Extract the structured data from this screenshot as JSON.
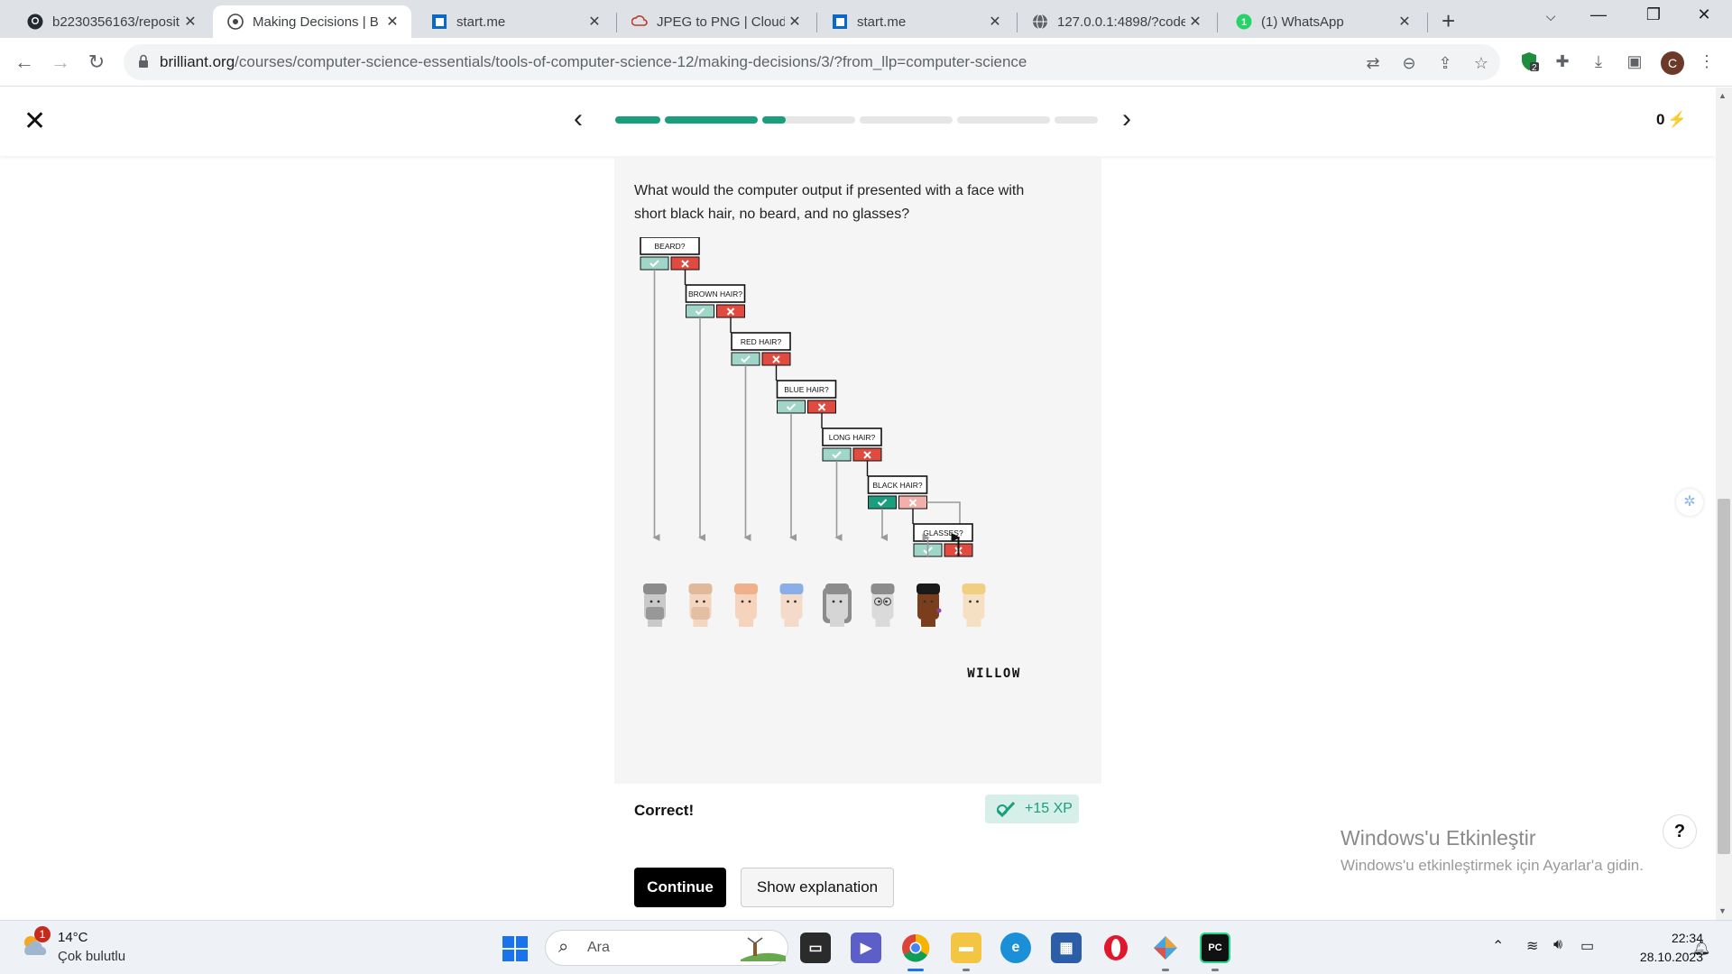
{
  "browser": {
    "tabs": [
      {
        "title": "b2230356163/reposit",
        "icon": "github-icon",
        "active": false
      },
      {
        "title": "Making Decisions | B",
        "icon": "brilliant-icon",
        "active": true
      },
      {
        "title": "start.me",
        "icon": "startme-icon",
        "active": false
      },
      {
        "title": "JPEG to PNG | Cloud",
        "icon": "cloudconvert-icon",
        "active": false
      },
      {
        "title": "start.me",
        "icon": "startme-icon",
        "active": false
      },
      {
        "title": "127.0.0.1:4898/?code",
        "icon": "globe-icon",
        "active": false
      },
      {
        "title": "(1) WhatsApp",
        "icon": "whatsapp-icon",
        "active": false
      }
    ],
    "url_domain": "brilliant.org",
    "url_path": "/courses/computer-science-essentials/tools-of-computer-science-12/making-decisions/3/?from_llp=computer-science",
    "extension_badge": "2",
    "profile_initial": "C"
  },
  "lesson": {
    "progress_segments": [
      1,
      1,
      0.25,
      0,
      0,
      0
    ],
    "score": "0",
    "question": "What would the computer output if presented with a face with short black hair, no beard, and no glasses?",
    "nodes": [
      "BEARD?",
      "BROWN HAIR?",
      "RED HAIR?",
      "BLUE HAIR?",
      "LONG HAIR?",
      "BLACK HAIR?",
      "GLASSES?"
    ],
    "answer_label": "WILLOW",
    "feedback": "Correct!",
    "xp": "+15 XP",
    "continue_label": "Continue",
    "explain_label": "Show explanation",
    "colors": {
      "accent": "#1a9e7e",
      "yes": "#9fd6c8",
      "no": "#e04a3f",
      "yes_active": "#1a9e7e",
      "no_faded": "#f2b0ab"
    }
  },
  "overlay": {
    "activation_title": "Windows'u Etkinleştir",
    "activation_sub": "Windows'u etkinleştirmek için Ayarlar'a gidin.",
    "help": "?"
  },
  "taskbar": {
    "notification_count": "1",
    "temperature": "14°C",
    "weather": "Çok bulutlu",
    "search_placeholder": "Ara",
    "time": "22:34",
    "date": "28.10.2023"
  }
}
